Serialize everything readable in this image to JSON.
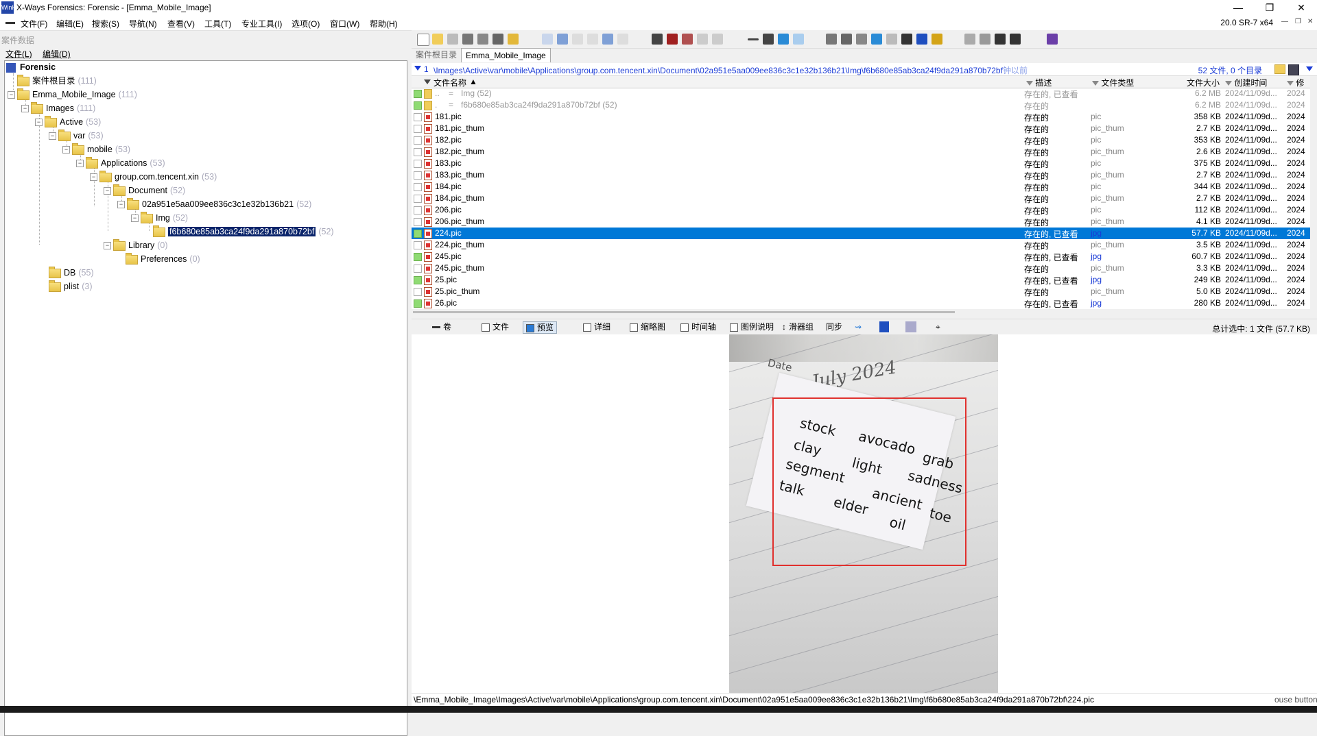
{
  "window": {
    "title": "X-Ways Forensics: Forensic - [Emma_Mobile_Image]",
    "app_icon": "WinHex",
    "version": "20.0 SR-7 x64",
    "controls": [
      "—",
      "❐",
      "✕"
    ],
    "mdi_controls": [
      "—",
      "❐",
      "✕"
    ]
  },
  "menubar": [
    "文件(F)",
    "编辑(E)",
    "搜索(S)",
    "导航(N)",
    "查看(V)",
    "工具(T)",
    "专业工具(I)",
    "选项(O)",
    "窗口(W)",
    "帮助(H)"
  ],
  "left_panel": {
    "title": "案件数据",
    "menu": [
      "文件(L)",
      "编辑(D)"
    ],
    "tree": [
      {
        "label": "Forensic",
        "count": ""
      },
      {
        "label": "案件根目录",
        "count": "(111)"
      },
      {
        "label": "Emma_Mobile_Image",
        "count": "(111)"
      },
      {
        "label": "Images",
        "count": "(111)"
      },
      {
        "label": "Active",
        "count": "(53)"
      },
      {
        "label": "var",
        "count": "(53)"
      },
      {
        "label": "mobile",
        "count": "(53)"
      },
      {
        "label": "Applications",
        "count": "(53)"
      },
      {
        "label": "group.com.tencent.xin",
        "count": "(53)"
      },
      {
        "label": "Document",
        "count": "(52)"
      },
      {
        "label": "02a951e5aa009ee836c3c1e32b136b21",
        "count": "(52)"
      },
      {
        "label": "Img",
        "count": "(52)"
      },
      {
        "label": "f6b680e85ab3ca24f9da291a870b72bf",
        "count": "(52)"
      },
      {
        "label": "Library",
        "count": "(0)"
      },
      {
        "label": "Preferences",
        "count": "(0)"
      },
      {
        "label": "DB",
        "count": "(55)"
      },
      {
        "label": "plist",
        "count": "(3)"
      }
    ]
  },
  "tabs": [
    "案件根目录",
    "Emma_Mobile_Image"
  ],
  "pathbar": {
    "num": "1",
    "path": "\\Images\\Active\\var\\mobile\\Applications\\group.com.tencent.xin\\Document\\02a951e5aa009ee836c3c1e32b136b21\\Img\\f6b680e85ab3ca24f9da291a870b72bf",
    "suffix": "钟以前",
    "summary": "52 文件, 0 个目录"
  },
  "columns": {
    "name": "文件名称",
    "desc": "描述",
    "type": "文件类型",
    "size": "文件大小",
    "created": "创建时间",
    "modified": "修"
  },
  "rows": [
    {
      "name": "..",
      "sym": "=",
      "extra": "Img",
      "extra_count": "(52)",
      "desc": "存在的, 已查看",
      "type": "",
      "size": "6.2 MB",
      "date": "2024/11/09d...",
      "date2": "2024",
      "parent": true,
      "check": "green"
    },
    {
      "name": ".",
      "sym": "=",
      "extra": "f6b680e85ab3ca24f9da291a870b72bf",
      "extra_count": "(52)",
      "desc": "存在的",
      "type": "",
      "size": "6.2 MB",
      "date": "2024/11/09d...",
      "date2": "2024",
      "parent": true,
      "check": "green"
    },
    {
      "name": "181.pic",
      "desc": "存在的",
      "type": "pic",
      "size": "358 KB",
      "date": "2024/11/09d...",
      "date2": "2024"
    },
    {
      "name": "181.pic_thum",
      "desc": "存在的",
      "type": "pic_thum",
      "size": "2.7 KB",
      "date": "2024/11/09d...",
      "date2": "2024"
    },
    {
      "name": "182.pic",
      "desc": "存在的",
      "type": "pic",
      "size": "353 KB",
      "date": "2024/11/09d...",
      "date2": "2024"
    },
    {
      "name": "182.pic_thum",
      "desc": "存在的",
      "type": "pic_thum",
      "size": "2.6 KB",
      "date": "2024/11/09d...",
      "date2": "2024"
    },
    {
      "name": "183.pic",
      "desc": "存在的",
      "type": "pic",
      "size": "375 KB",
      "date": "2024/11/09d...",
      "date2": "2024"
    },
    {
      "name": "183.pic_thum",
      "desc": "存在的",
      "type": "pic_thum",
      "size": "2.7 KB",
      "date": "2024/11/09d...",
      "date2": "2024"
    },
    {
      "name": "184.pic",
      "desc": "存在的",
      "type": "pic",
      "size": "344 KB",
      "date": "2024/11/09d...",
      "date2": "2024"
    },
    {
      "name": "184.pic_thum",
      "desc": "存在的",
      "type": "pic_thum",
      "size": "2.7 KB",
      "date": "2024/11/09d...",
      "date2": "2024"
    },
    {
      "name": "206.pic",
      "desc": "存在的",
      "type": "pic",
      "size": "112 KB",
      "date": "2024/11/09d...",
      "date2": "2024"
    },
    {
      "name": "206.pic_thum",
      "desc": "存在的",
      "type": "pic_thum",
      "size": "4.1 KB",
      "date": "2024/11/09d...",
      "date2": "2024"
    },
    {
      "name": "224.pic",
      "desc": "存在的, 已查看",
      "type": "jpg",
      "size": "57.7 KB",
      "date": "2024/11/09d...",
      "date2": "2024",
      "selected": true,
      "check": "green"
    },
    {
      "name": "224.pic_thum",
      "desc": "存在的",
      "type": "pic_thum",
      "size": "3.5 KB",
      "date": "2024/11/09d...",
      "date2": "2024"
    },
    {
      "name": "245.pic",
      "desc": "存在的, 已查看",
      "type": "jpg",
      "size": "60.7 KB",
      "date": "2024/11/09d...",
      "date2": "2024",
      "check": "green"
    },
    {
      "name": "245.pic_thum",
      "desc": "存在的",
      "type": "pic_thum",
      "size": "3.3 KB",
      "date": "2024/11/09d...",
      "date2": "2024"
    },
    {
      "name": "25.pic",
      "desc": "存在的, 已查看",
      "type": "jpg",
      "size": "249 KB",
      "date": "2024/11/09d...",
      "date2": "2024",
      "check": "green"
    },
    {
      "name": "25.pic_thum",
      "desc": "存在的",
      "type": "pic_thum",
      "size": "5.0 KB",
      "date": "2024/11/09d...",
      "date2": "2024"
    },
    {
      "name": "26.pic",
      "desc": "存在的, 已查看",
      "type": "jpg",
      "size": "280 KB",
      "date": "2024/11/09d...",
      "date2": "2024",
      "check": "green"
    }
  ],
  "view_tabs": [
    "卷",
    "文件",
    "预览",
    "详细",
    "缩略图",
    "时间轴",
    "图例说明",
    "滑器组",
    "同步"
  ],
  "view_selection": "总计选中: 1 文件 (57.7 KB)",
  "preview": {
    "date_label": "Date",
    "date_value": "July 2024",
    "words": [
      "stock",
      "avocado",
      "grab",
      "clay",
      "light",
      "sadness",
      "segment",
      "ancient",
      "toe",
      "talk",
      "elder",
      "oil"
    ]
  },
  "status": {
    "path": "\\Emma_Mobile_Image\\Images\\Active\\var\\mobile\\Applications\\group.com.tencent.xin\\Document\\02a951e5aa009ee836c3c1e32b136b21\\Img\\f6b680e85ab3ca24f9da291a870b72bf\\224.pic",
    "hint": "ouse button to mirror, with Shift to flip"
  },
  "colors": {
    "selection": "#0078d7",
    "path_blue": "#1a3bd6",
    "annotation_red": "#e0302d"
  }
}
